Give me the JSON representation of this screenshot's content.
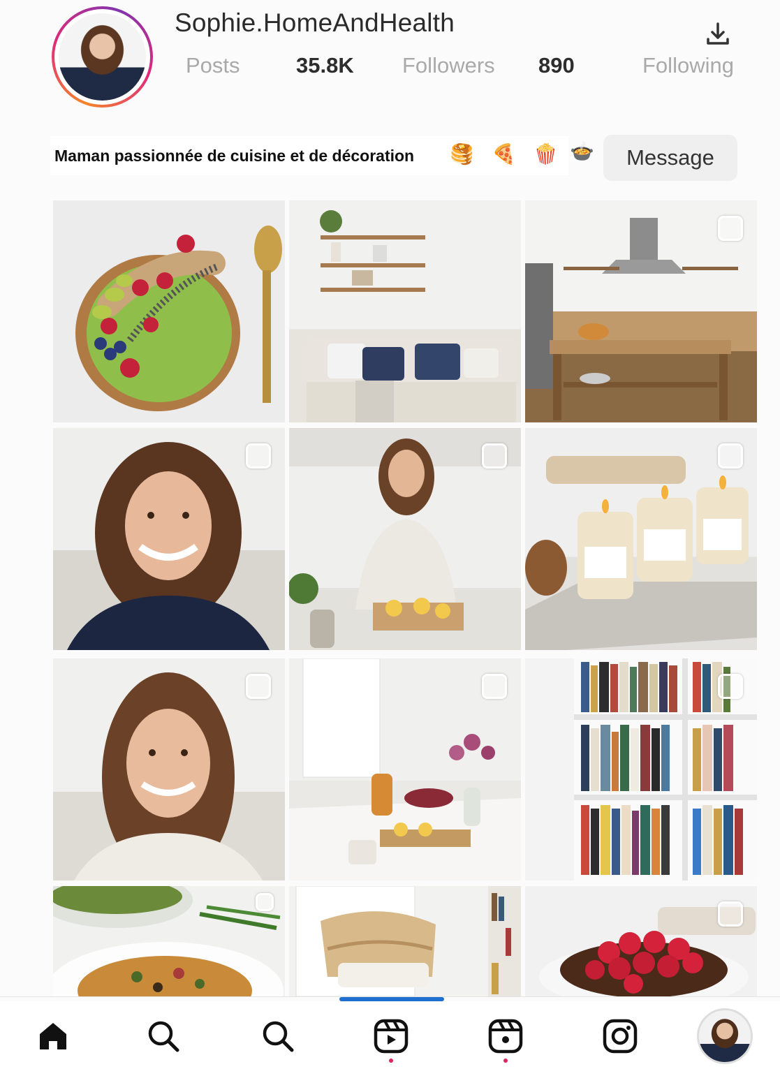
{
  "profile": {
    "username": "Sophie.HomeAndHealth",
    "stats": {
      "posts_label": "Posts",
      "followers_value": "35.8K",
      "followers_label": "Followers",
      "following_value": "890",
      "following_label": "Following"
    },
    "bio": "Maman passionnée de cuisine et de décoration",
    "bio_emojis": [
      "🥞",
      "🍕",
      "🍿",
      "🍲"
    ],
    "message_button": "Message"
  },
  "grid": {
    "posts": [
      {
        "subject": "green smoothie bowl",
        "multi_select": false
      },
      {
        "subject": "living room shelves",
        "multi_select": false
      },
      {
        "subject": "kitchen island",
        "multi_select": true
      },
      {
        "subject": "portrait dark sweater",
        "multi_select": true
      },
      {
        "subject": "avocado toast kitchen",
        "multi_select": true
      },
      {
        "subject": "candles",
        "multi_select": true
      },
      {
        "subject": "portrait light sweater",
        "multi_select": true
      },
      {
        "subject": "breakfast table flowers",
        "multi_select": true
      },
      {
        "subject": "bookshelf",
        "multi_select": true
      },
      {
        "subject": "salad pasta",
        "multi_select": true
      },
      {
        "subject": "rattan chair",
        "multi_select": false
      },
      {
        "subject": "raspberry cake",
        "multi_select": true
      }
    ]
  },
  "bottom_nav": {
    "items": [
      "home-icon",
      "search-icon",
      "search-icon",
      "reels-icon",
      "reels-icon",
      "instagram-icon",
      "profile-avatar"
    ],
    "active_index": 3
  },
  "colors": {
    "accent_blue": "#1f6fd1",
    "notification_red": "#e0245e",
    "story_ring": [
      "#f58529",
      "#dd2a7b",
      "#8134af"
    ]
  }
}
